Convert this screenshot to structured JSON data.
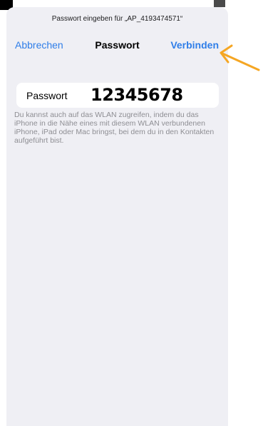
{
  "dialog": {
    "prompt": "Passwort eingeben für „AP_4193474571“",
    "cancel_label": "Abbrechen",
    "title": "Passwort",
    "connect_label": "Verbinden"
  },
  "password_field": {
    "label": "Passwort",
    "value": "12345678"
  },
  "hint": {
    "text": "Du kannst auch auf das WLAN zugreifen, indem du das iPhone in die Nähe eines mit diesem WLAN verbundenen iPhone, iPad oder Mac bringst, bei dem du in den Kontakten aufgeführt bist."
  },
  "colors": {
    "accent": "#2f7ee8",
    "sheet_background": "#efeff4",
    "hint_text": "#8e8e93",
    "annotation_arrow": "#f5a623"
  },
  "icons": {
    "annotation": "arrow-pointing-left-icon"
  }
}
